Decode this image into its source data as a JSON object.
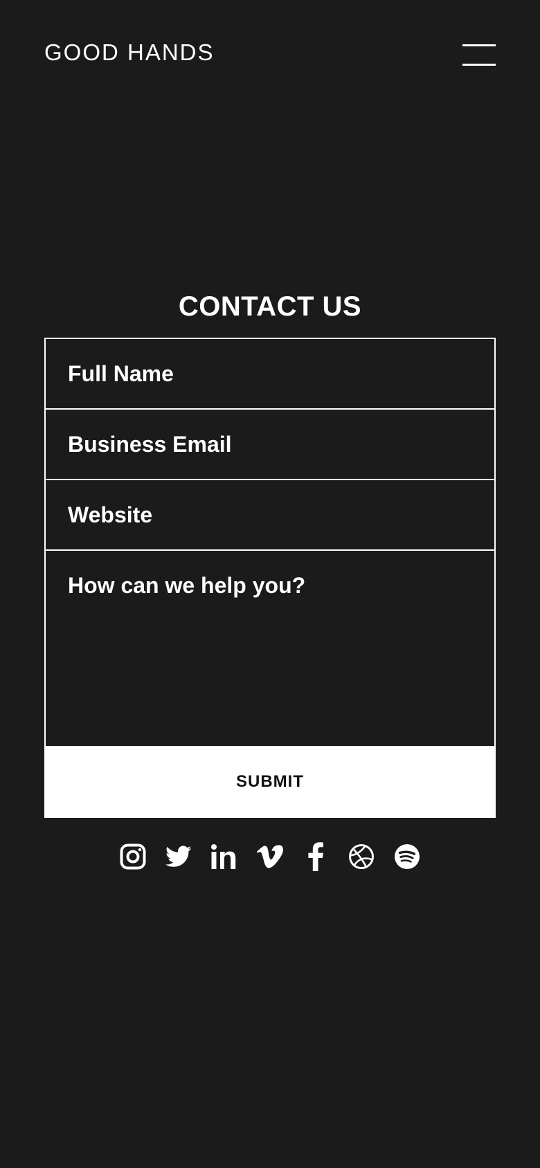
{
  "header": {
    "brand": "GOOD HANDS",
    "menu_icon": "hamburger-menu-icon"
  },
  "contact": {
    "title": "CONTACT US",
    "fields": {
      "full_name": {
        "placeholder": "Full Name",
        "value": ""
      },
      "business_email": {
        "placeholder": "Business Email",
        "value": ""
      },
      "website": {
        "placeholder": "Website",
        "value": ""
      },
      "message": {
        "placeholder": "How can we help you?",
        "value": ""
      }
    },
    "submit_label": "SUBMIT"
  },
  "socials": [
    {
      "icon": "instagram-icon"
    },
    {
      "icon": "twitter-icon"
    },
    {
      "icon": "linkedin-icon"
    },
    {
      "icon": "vimeo-icon"
    },
    {
      "icon": "facebook-icon"
    },
    {
      "icon": "dribbble-icon"
    },
    {
      "icon": "spotify-icon"
    }
  ],
  "colors": {
    "background": "#1b1b1b",
    "foreground": "#ffffff",
    "button_text": "#111111"
  }
}
